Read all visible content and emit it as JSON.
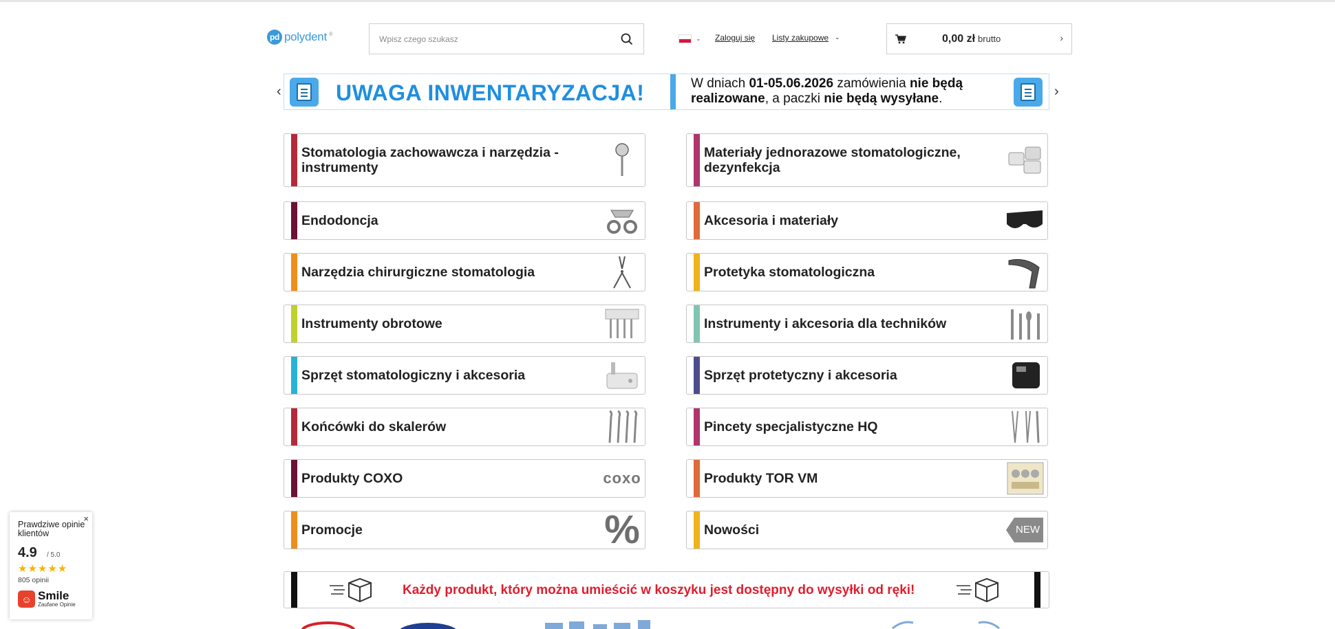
{
  "header": {
    "logo_text": "polydent",
    "logo_mark": "pd",
    "logo_tm": "®",
    "search_placeholder": "Wpisz czego szukasz",
    "search_icon": "search-icon",
    "language_flag": "poland-flag-icon",
    "login_label": "Zaloguj się",
    "lists_label": "Listy zakupowe",
    "cart": {
      "amount": "0,00 zł",
      "suffix": "brutto",
      "icon": "cart-icon"
    }
  },
  "banner": {
    "prev": "‹",
    "next": "›",
    "title": "UWAGA INWENTARYZACJA!",
    "text_part1": "W dniach ",
    "text_dates": "01-05.06.2026",
    "text_part2": " zamówienia ",
    "text_bold1": "nie będą realizowane",
    "text_part3": ", a paczki ",
    "text_bold2": "nie będą wysyłane",
    "text_part4": ".",
    "accent": "#1e8fe0"
  },
  "categories": [
    {
      "label": "Stomatologia zachowawcza i narzędzia - instrumenty",
      "color": "#b52a3a",
      "icon": "dental-mirror-icon"
    },
    {
      "label": "Materiały jednorazowe stomatologiczne, dezynfekcja",
      "color": "#b0356b",
      "icon": "sterile-containers-icon"
    },
    {
      "label": "Endodoncja",
      "color": "#6b1236",
      "icon": "dental-clamp-icon"
    },
    {
      "label": "Akcesoria i materiały",
      "color": "#e06a3a",
      "icon": "safety-glasses-icon"
    },
    {
      "label": "Narzędzia chirurgiczne stomatologia",
      "color": "#ef8e1c",
      "icon": "surgical-pliers-icon"
    },
    {
      "label": "Protetyka stomatologiczna",
      "color": "#f1b31c",
      "icon": "handpiece-icon"
    },
    {
      "label": "Instrumenty obrotowe",
      "color": "#bfd12c",
      "icon": "rotary-burs-icon"
    },
    {
      "label": "Instrumenty i akcesoria dla techników",
      "color": "#7fc5b2",
      "icon": "lab-burs-icon"
    },
    {
      "label": "Sprzęt stomatologiczny i akcesoria",
      "color": "#27b3d9",
      "icon": "dental-unit-icon"
    },
    {
      "label": "Sprzęt protetyczny i akcesoria",
      "color": "#4b4d8c",
      "icon": "lab-device-icon"
    },
    {
      "label": "Końcówki do skalerów",
      "color": "#b52a3a",
      "icon": "scaler-tips-icon"
    },
    {
      "label": "Pincety specjalistyczne HQ",
      "color": "#b0356b",
      "icon": "tweezers-icon"
    },
    {
      "label": "Produkty COXO",
      "color": "#6b1236",
      "icon": "coxo-logo-icon",
      "thumb_text": "coxo"
    },
    {
      "label": "Produkty TOR VM",
      "color": "#e06a3a",
      "icon": "tor-vm-kit-icon"
    },
    {
      "label": "Promocje",
      "color": "#ef8e1c",
      "icon": "percent-icon",
      "thumb_text": "%"
    },
    {
      "label": "Nowości",
      "color": "#f1b31c",
      "icon": "new-badge-icon",
      "thumb_text": "NEW"
    }
  ],
  "shipping": {
    "text": "Każdy produkt, który można umieścić w koszyku jest dostępny do wysyłki od ręki!",
    "icon": "delivery-box-icon",
    "accent": "#e21d2c"
  },
  "reviews_widget": {
    "title": "Prawdziwe opinie klientów",
    "score": "4.9",
    "max": "/ 5.0",
    "stars": "★★★★★",
    "count": "805 opinii",
    "brand": "Smile",
    "brand_sub": "Zaufane Opinie",
    "close": "×"
  }
}
